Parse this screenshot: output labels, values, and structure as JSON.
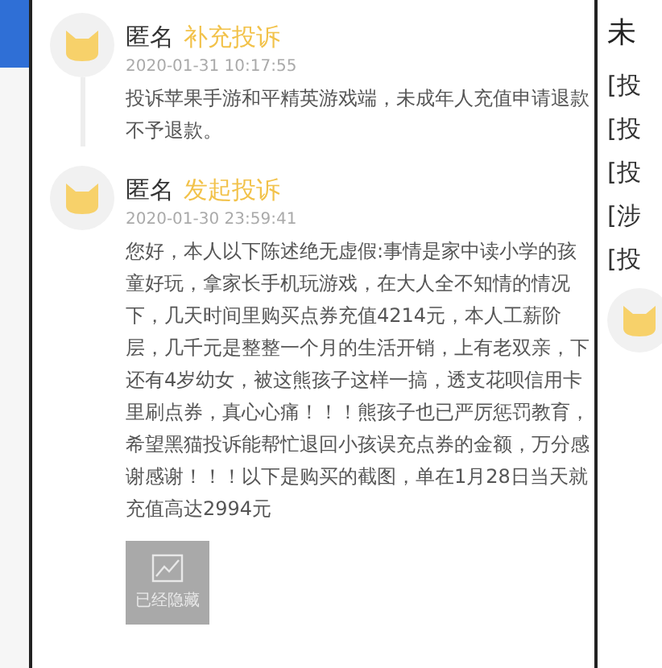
{
  "entries": [
    {
      "author": "匿名",
      "action": "补充投诉",
      "time": "2020-01-31 10:17:55",
      "text": "投诉苹果手游和平精英游戏端，未成年人充值申请退款不予退款。"
    },
    {
      "author": "匿名",
      "action": "发起投诉",
      "time": "2020-01-30 23:59:41",
      "text": "您好，本人以下陈述绝无虚假:事情是家中读小学的孩童好玩，拿家长手机玩游戏，在大人全不知情的情况下，几天时间里购买点券充值4214元，本人工薪阶层，几千元是整整一个月的生活开销，上有老双亲，下还有4岁幼女，被这熊孩子这样一搞，透支花呗信用卡里刷点券，真心心痛！！！熊孩子也已严厉惩罚教育，希望黑猫投诉能帮忙退回小孩误充点券的金额，万分感谢感谢！！！以下是购买的截图，单在1月28日当天就充值高达2994元",
      "attachment": {
        "label": "已经隐藏"
      }
    }
  ],
  "right_panel": {
    "title": "未",
    "items": [
      "[投",
      "[投",
      "[投",
      "[涉",
      "[投"
    ]
  }
}
